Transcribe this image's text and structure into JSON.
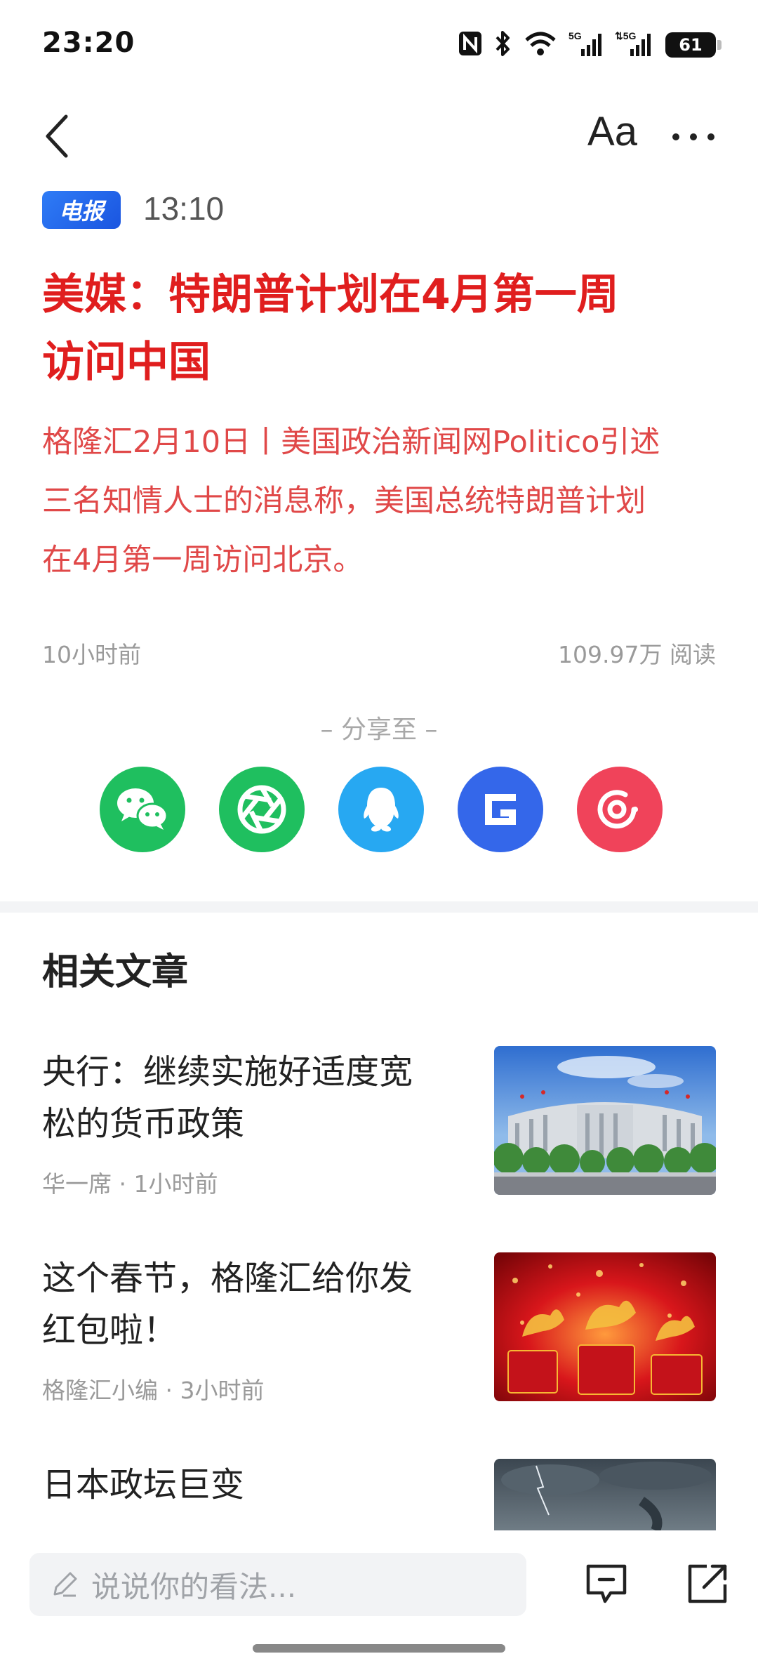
{
  "status_bar": {
    "time": "23:20",
    "battery": "61",
    "icons": [
      "nfc-icon",
      "bluetooth-icon",
      "wifi-icon",
      "signal-5g-icon",
      "signal-5g-icon"
    ]
  },
  "nav": {
    "back_icon": "chevron-left-icon",
    "font_size_label": "Aa",
    "more_icon": "more-horizontal-icon"
  },
  "article": {
    "badge": "电报",
    "time": "13:10",
    "headline_line1": "美媒：特朗普计划在4月第一周",
    "headline_line2": "访问中国",
    "summary_line1": "格隆汇2月10日丨美国政治新闻网Politico引述",
    "summary_line2": "三名知情人士的消息称，美国总统特朗普计划",
    "summary_line3": "在4月第一周访问北京。",
    "posted_ago": "10小时前",
    "reads": "109.97万 阅读",
    "colors": {
      "headline": "#e01e1e",
      "summary": "#e04848",
      "badge": "#2563eb"
    }
  },
  "share": {
    "title": "– 分享至 –",
    "targets": [
      {
        "icon": "wechat-icon",
        "color": "#1fbf5f"
      },
      {
        "icon": "moments-icon",
        "color": "#1fbf5f"
      },
      {
        "icon": "qq-icon",
        "color": "#27a8f2"
      },
      {
        "icon": "gelonghui-icon",
        "color": "#3467ea"
      },
      {
        "icon": "weibo-icon",
        "color": "#f0435a"
      }
    ]
  },
  "related": {
    "title": "相关文章",
    "items": [
      {
        "title_line1": "央行：继续实施好适度宽",
        "title_line2": "松的货币政策",
        "meta": "华一席 · 1小时前",
        "thumb": "central-bank-building-image"
      },
      {
        "title_line1": "这个春节，格隆汇给你发",
        "title_line2": "红包啦！",
        "meta": "格隆汇小编 · 3小时前",
        "thumb": "red-envelope-horses-image"
      },
      {
        "title_line1": "日本政坛巨变",
        "title_line2": "",
        "meta": "",
        "thumb": "storm-clouds-image"
      }
    ]
  },
  "bottom_bar": {
    "comment_placeholder": "说说你的看法...",
    "comment_icon": "comment-icon",
    "share_icon": "share-icon"
  }
}
